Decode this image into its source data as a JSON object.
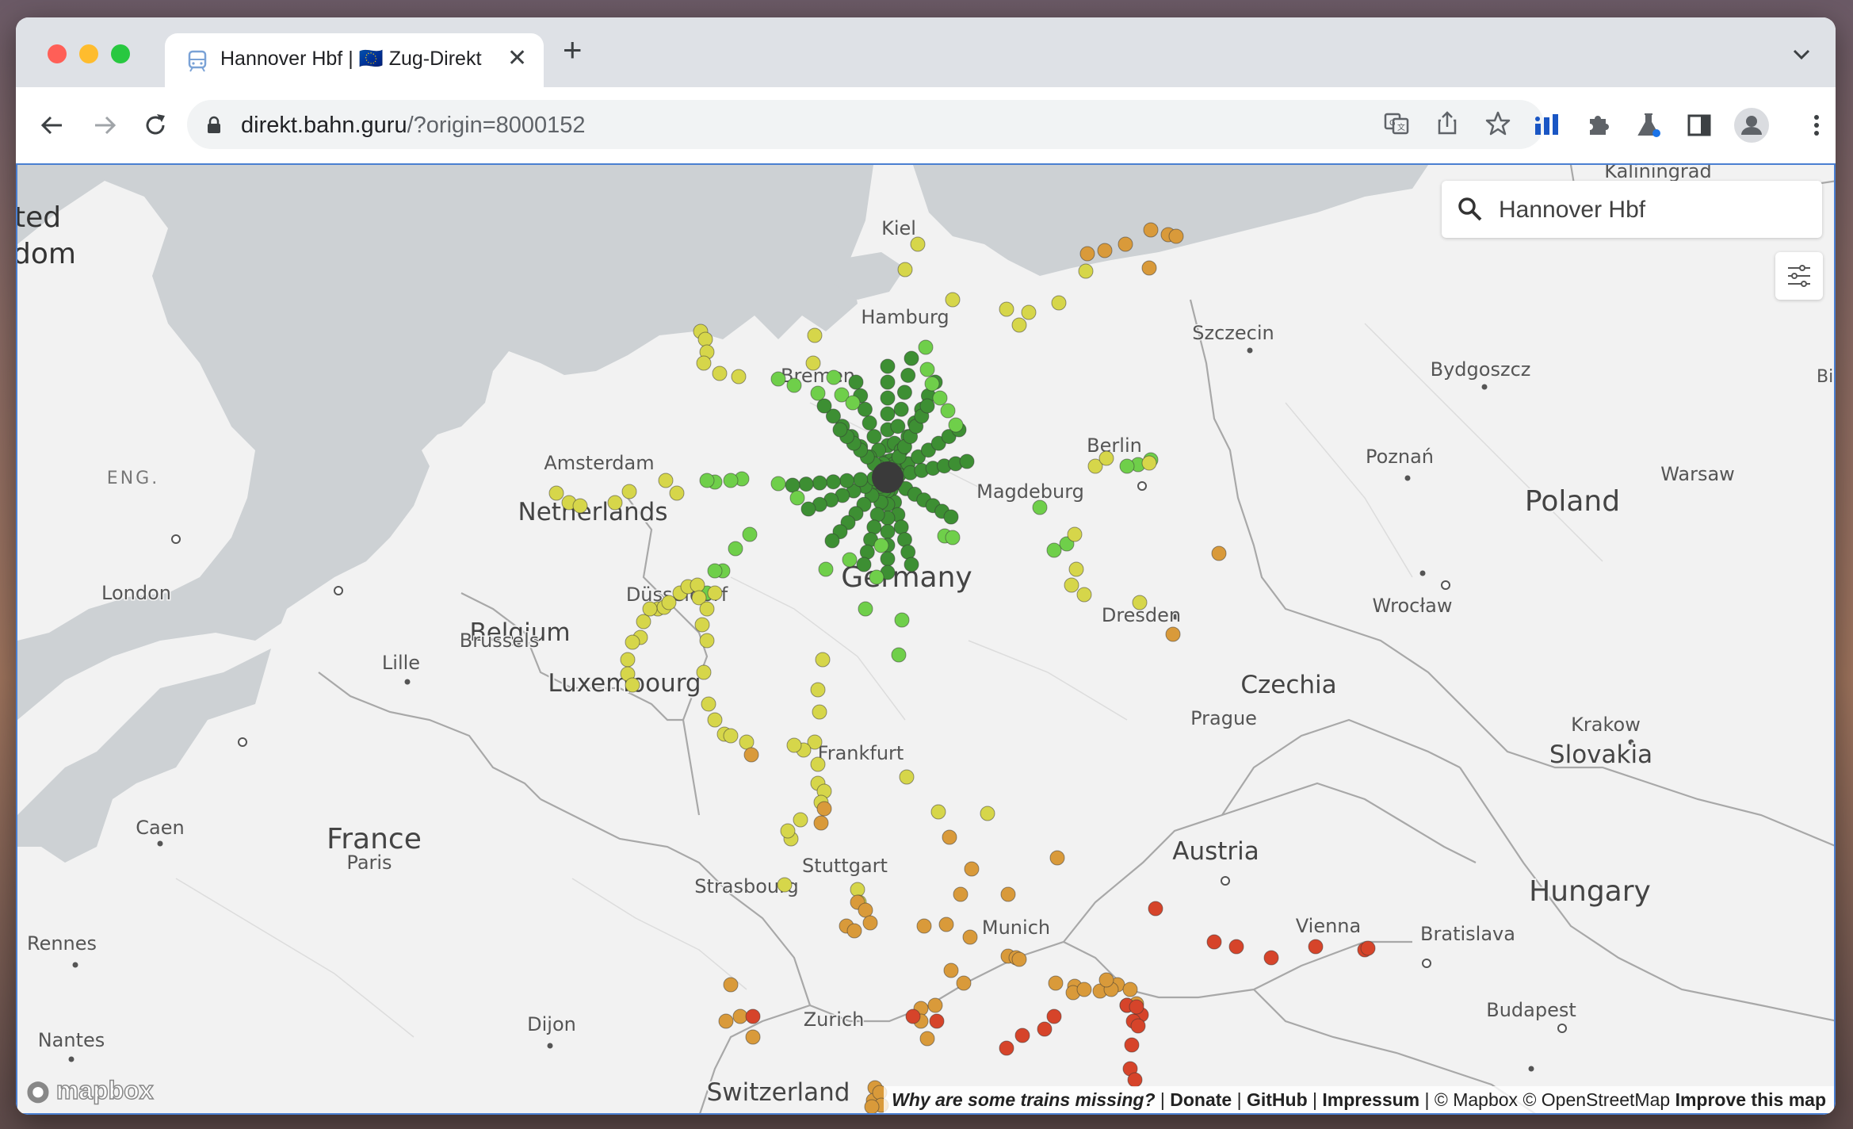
{
  "browser": {
    "tab_title": "Hannover Hbf | 🇪🇺 Zug-Direktverbindungen",
    "url_host": "direkt.bahn.guru",
    "url_path": "/?origin=8000152"
  },
  "search": {
    "value": "Hannover Hbf"
  },
  "map_labels": {
    "countries": [
      "Netherlands",
      "Belgium",
      "Luxembourg",
      "Germany",
      "France",
      "Switzerland",
      "Austria",
      "Czechia",
      "Poland",
      "Slovakia",
      "Hungary"
    ],
    "cities": [
      "Kiel",
      "Hamburg",
      "Bremen",
      "Amsterdam",
      "Berlin",
      "Magdeburg",
      "Szczecin",
      "Bydgoszcz",
      "Poznań",
      "Warsaw",
      "Düsseldorf",
      "Brussels",
      "Lille",
      "London",
      "Dresden",
      "Wrocław",
      "Prague",
      "Krakow",
      "Frankfurt",
      "Stuttgart",
      "Strasbourg",
      "Munich",
      "Vienna",
      "Bratislava",
      "Budapest",
      "Zurich",
      "Paris",
      "Caen",
      "Rennes",
      "Nantes",
      "Dijon",
      "Kaliningrad",
      "ENG."
    ],
    "edge_left": "ted\ndom",
    "edge_right": "Bi"
  },
  "attribution": {
    "missing": "Why are some trains missing?",
    "donate": "Donate",
    "github": "GitHub",
    "impressum": "Impressum",
    "mapbox": "© Mapbox",
    "osm": "© OpenStreetMap",
    "improve": "Improve this map",
    "sep": "|"
  },
  "logo": "mapbox",
  "colors": {
    "origin": "#3a3a3a",
    "very_near": "#3d8f33",
    "near": "#6fcf4a",
    "mid": "#d6d64a",
    "far": "#d99a3a",
    "very_far": "#d6442a"
  }
}
